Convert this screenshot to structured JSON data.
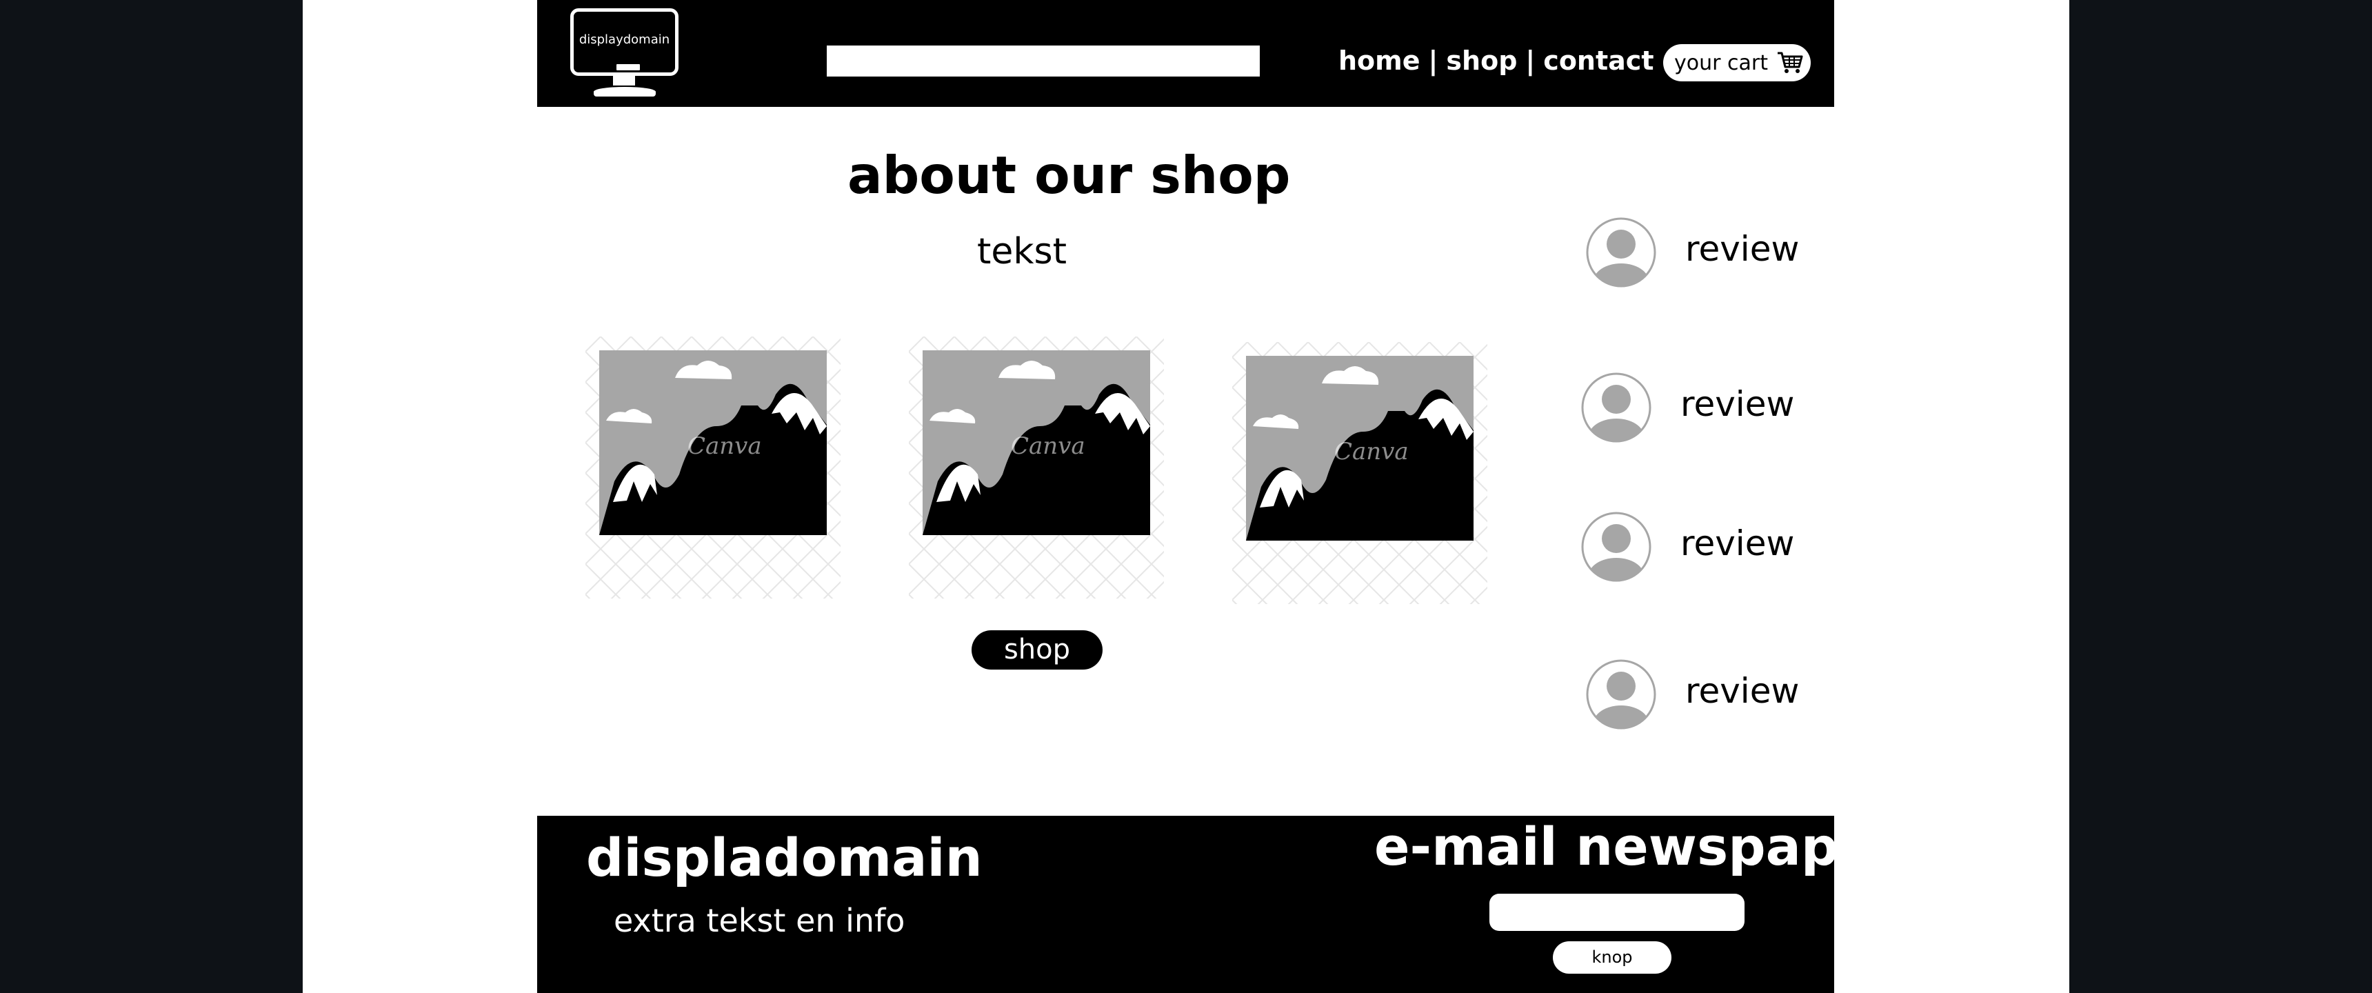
{
  "header": {
    "logo_text": "displaydomain",
    "search_value": "",
    "nav": {
      "home": "home",
      "separator": "|",
      "shop": "shop",
      "contact": "contact"
    },
    "cart_label": "your cart",
    "cart_icon": "shopping-cart-icon"
  },
  "main": {
    "title": "about our shop",
    "subtitle": "tekst",
    "images": [
      {
        "icon": "mountain-landscape-image",
        "watermark": "Canva"
      },
      {
        "icon": "mountain-landscape-image",
        "watermark": "Canva"
      },
      {
        "icon": "mountain-landscape-image",
        "watermark": "Canva"
      }
    ],
    "shop_button": "shop"
  },
  "reviews": [
    {
      "icon": "user-avatar-icon",
      "label": "review"
    },
    {
      "icon": "user-avatar-icon",
      "label": "review"
    },
    {
      "icon": "user-avatar-icon",
      "label": "review"
    },
    {
      "icon": "user-avatar-icon",
      "label": "review"
    }
  ],
  "footer": {
    "brand": "displadomain",
    "info": "extra tekst en info",
    "newsletter_title": "e-mail newspaper",
    "email_value": "",
    "submit_button": "knop"
  },
  "colors": {
    "page_background": "#0e1217",
    "canvas": "#ffffff",
    "bars": "#000000",
    "image_gray": "#a6a6a6"
  }
}
